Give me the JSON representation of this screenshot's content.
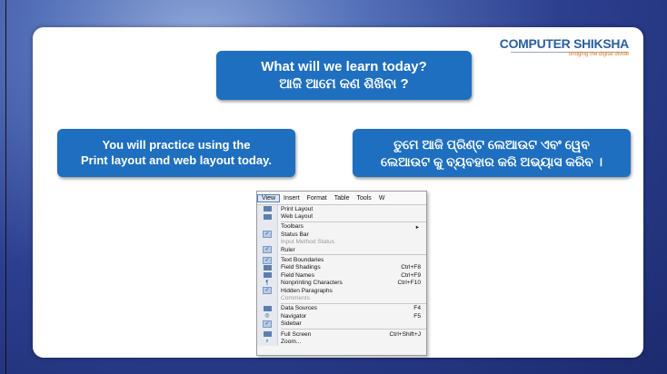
{
  "logo": {
    "brand": "COMPUTER SHIKSHA",
    "tagline": "bridging the digital divide"
  },
  "title_box": {
    "line1": "What will we learn today?",
    "line2": "ଆଜି ଆମେ କଣ ଶିଖିବା ?"
  },
  "left_box": {
    "line1": "You will practice using the",
    "line2": "Print layout and web layout today."
  },
  "right_box": {
    "line1": "ତୁମେ ଆଜି ପ୍ରିଣ୍ଟ ଲେଆଉଟ ଏବଂ ୱେବ",
    "line2": "ଲେଆଉଟ କୁ ବ୍ୟବହାର କରି ଅଭ୍ୟାସ କରିବ ।"
  },
  "menubar": [
    "View",
    "Insert",
    "Format",
    "Table",
    "Tools",
    "W"
  ],
  "menu": {
    "print_layout": "Print Layout",
    "web_layout": "Web Layout",
    "toolbars": "Toolbars",
    "status_bar": "Status Bar",
    "input_method_status": "Input Method Status",
    "ruler": "Ruler",
    "text_boundaries": "Text Boundaries",
    "field_shadings": "Field Shadings",
    "field_shadings_sc": "Ctrl+F8",
    "field_names": "Field Names",
    "field_names_sc": "Ctrl+F9",
    "nonprinting": "Nonprinting Characters",
    "nonprinting_sc": "Ctrl+F10",
    "hidden_paragraphs": "Hidden Paragraphs",
    "comments": "Comments",
    "data_sources": "Data Sources",
    "data_sources_sc": "F4",
    "navigator": "Navigator",
    "navigator_sc": "F5",
    "sidebar": "Sidebar",
    "full_screen": "Full Screen",
    "full_screen_sc": "Ctrl+Shift+J",
    "zoom": "Zoom..."
  },
  "colors": {
    "callout": "#1e6fbf",
    "brand": "#2b5f9e",
    "background": "#2c3f8f"
  }
}
